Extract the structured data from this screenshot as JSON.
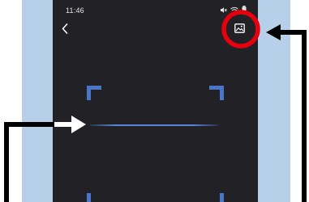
{
  "status_bar": {
    "time": "11:46",
    "icons": [
      "mute-icon",
      "wifi-icon",
      "battery-icon"
    ]
  },
  "toolbar": {
    "back_icon": "chevron-left-icon",
    "gallery_icon": "image-gallery-icon"
  },
  "annotations": {
    "highlight_color": "#e8000f",
    "arrow_color": "#000000"
  },
  "colors": {
    "accent": "#4a76c9",
    "screen_background": "#222226",
    "backdrop": "#b8cfe9"
  }
}
